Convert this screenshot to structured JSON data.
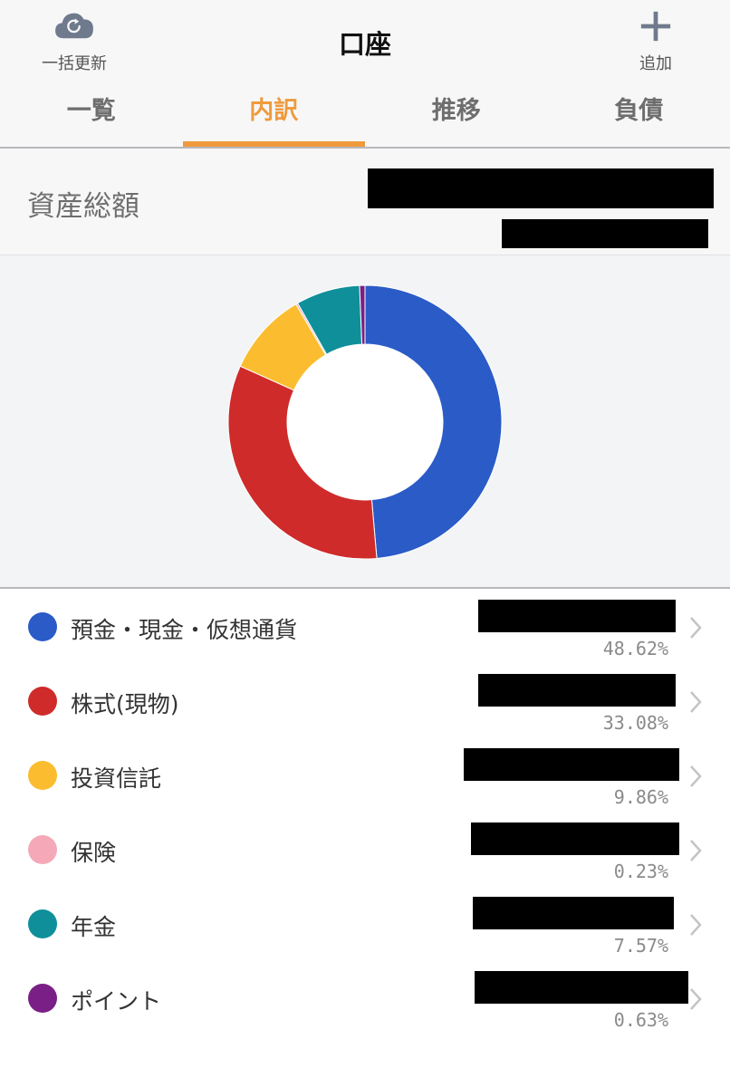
{
  "header": {
    "title": "口座",
    "refresh_label": "一括更新",
    "add_label": "追加"
  },
  "tabs": [
    {
      "label": "一覧",
      "active": false
    },
    {
      "label": "内訳",
      "active": true
    },
    {
      "label": "推移",
      "active": false
    },
    {
      "label": "負債",
      "active": false
    }
  ],
  "total": {
    "label": "資産総額"
  },
  "colors": {
    "accent": "#ef9a3d"
  },
  "chart_data": {
    "type": "pie",
    "donut": true,
    "categories": [
      "預金・現金・仮想通貨",
      "株式(現物)",
      "投資信託",
      "保険",
      "年金",
      "ポイント"
    ],
    "values": [
      48.62,
      33.08,
      9.86,
      0.23,
      7.57,
      0.63
    ],
    "percent_labels": [
      "48.62%",
      "33.08%",
      "9.86%",
      "0.23%",
      "7.57%",
      "0.63%"
    ],
    "colors": [
      "#2a5bc7",
      "#cf2b2b",
      "#fbbd2f",
      "#f5a9b8",
      "#0f8f9a",
      "#7a1f86"
    ],
    "start": "top",
    "direction": "clockwise"
  }
}
